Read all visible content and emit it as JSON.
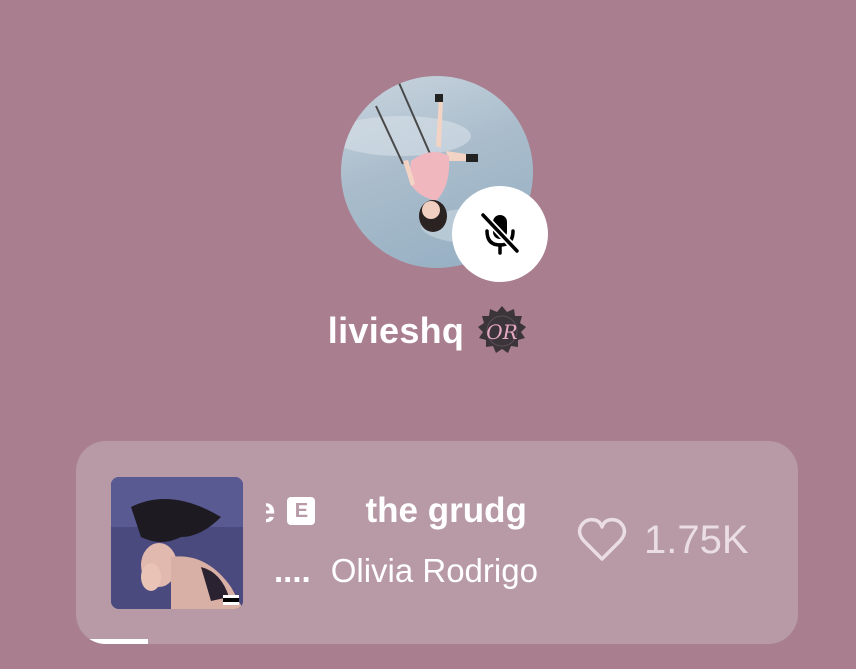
{
  "profile": {
    "username": "livieshq",
    "avatar_icon": "profile-photo",
    "status_icon": "mic-muted-icon",
    "badge_icon": "olivia-rodrigo-seal-badge",
    "badge_text": "OR"
  },
  "now_playing": {
    "title_partial": "e",
    "explicit_label": "E",
    "next_title": "the grudg",
    "separator": "....",
    "artist": "Olivia Rodrigo",
    "like_icon": "heart-outline-icon",
    "like_count": "1.75K",
    "progress": 0.1
  },
  "colors": {
    "background": "#a97e8e",
    "card": "#b79aa6",
    "text": "#ffffff",
    "like": "#eadde3"
  }
}
